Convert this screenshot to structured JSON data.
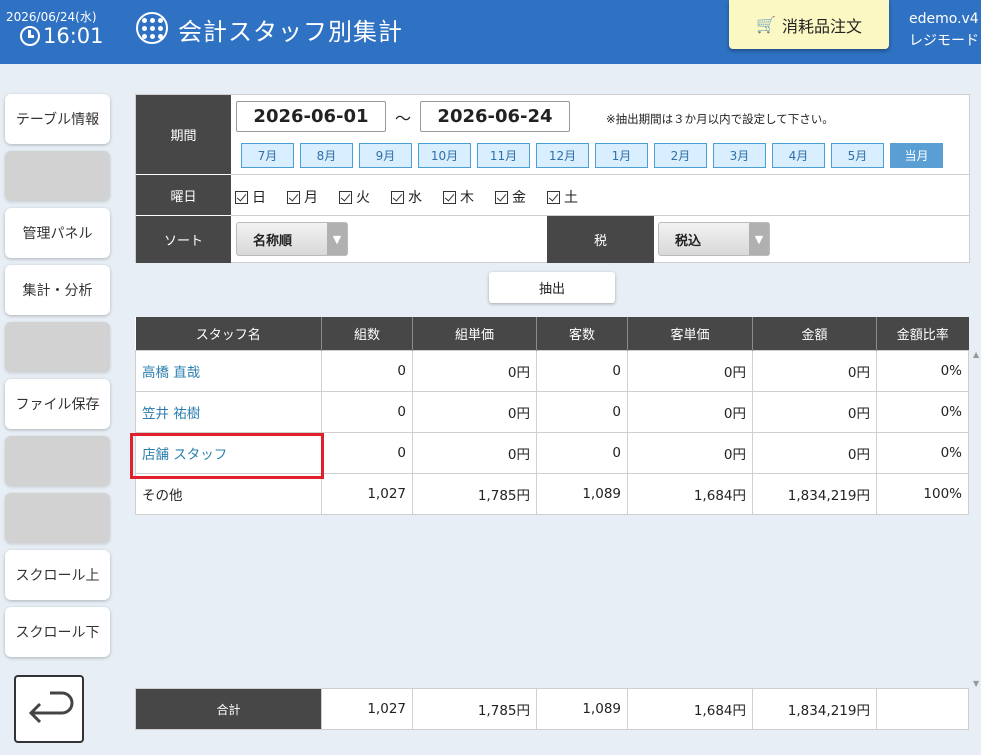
{
  "header": {
    "date": "2026/06/24(水)",
    "time": "16:01",
    "title": "会計スタッフ別集計",
    "order_button": "消耗品注文",
    "user_line1": "edemo.v4",
    "user_line2": "レジモード"
  },
  "sidebar": {
    "items": [
      {
        "label": "テーブル情報"
      },
      {
        "label": ""
      },
      {
        "label": "管理パネル"
      },
      {
        "label": "集計・分析"
      },
      {
        "label": ""
      },
      {
        "label": "ファイル保存"
      },
      {
        "label": ""
      },
      {
        "label": ""
      },
      {
        "label": "スクロール上"
      },
      {
        "label": "スクロール下"
      }
    ]
  },
  "filter": {
    "period_label": "期間",
    "start_date": "2026-06-01",
    "tilde": "～",
    "end_date": "2026-06-24",
    "note": "※抽出期間は３か月以内で設定して下さい。",
    "months": [
      "7月",
      "8月",
      "9月",
      "10月",
      "11月",
      "12月",
      "1月",
      "2月",
      "3月",
      "4月",
      "5月",
      "当月"
    ],
    "dow_label": "曜日",
    "days": [
      "日",
      "月",
      "火",
      "水",
      "木",
      "金",
      "土"
    ],
    "sort_label": "ソート",
    "sort_value": "名称順",
    "tax_label": "税",
    "tax_value": "税込"
  },
  "extract_button": "抽出",
  "table": {
    "headers": [
      "スタッフ名",
      "組数",
      "組単価",
      "客数",
      "客単価",
      "金額",
      "金額比率"
    ],
    "rows": [
      [
        "高橋 直哉",
        "0",
        "0円",
        "0",
        "0円",
        "0円",
        "0%"
      ],
      [
        "笠井 祐樹",
        "0",
        "0円",
        "0",
        "0円",
        "0円",
        "0%"
      ],
      [
        "店舗 スタッフ",
        "0",
        "0円",
        "0",
        "0円",
        "0円",
        "0%"
      ],
      [
        "その他",
        "1,027",
        "1,785円",
        "1,089",
        "1,684円",
        "1,834,219円",
        "100%"
      ]
    ]
  },
  "totals": [
    "合計",
    "1,027",
    "1,785円",
    "1,089",
    "1,684円",
    "1,834,219円",
    ""
  ],
  "colors": {
    "header_bg": "#2f72c4",
    "order_button_bg": "#fcf8c4",
    "dark_header": "#474747",
    "link": "#2c7fb0",
    "highlight": "#e0202a"
  }
}
